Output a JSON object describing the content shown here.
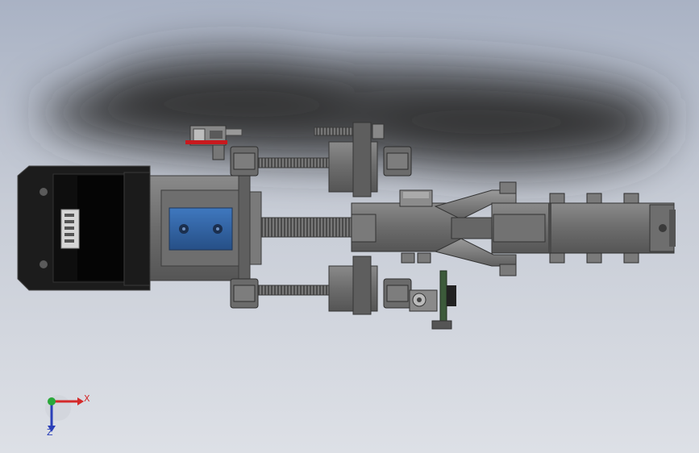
{
  "triad": {
    "x_label": "X",
    "z_label": "Z",
    "x_color": "#d42a2a",
    "z_color": "#2a3fb8",
    "y_color": "#2aa83a"
  },
  "colors": {
    "background_top": "#a9b2c4",
    "background_bottom": "#dde0e6",
    "shadow": "#2e2e2e",
    "motor_dark": "#1a1a1a",
    "metal_gray": "#6a6a6a",
    "metal_light": "#8c8c8c",
    "coupler_blue": "#2f5f9e",
    "accent_red": "#c8191e",
    "board_green": "#3c5a3a"
  },
  "icons": [
    "stepper-motor-icon",
    "lead-screw-icon",
    "coordinate-triad-icon"
  ]
}
